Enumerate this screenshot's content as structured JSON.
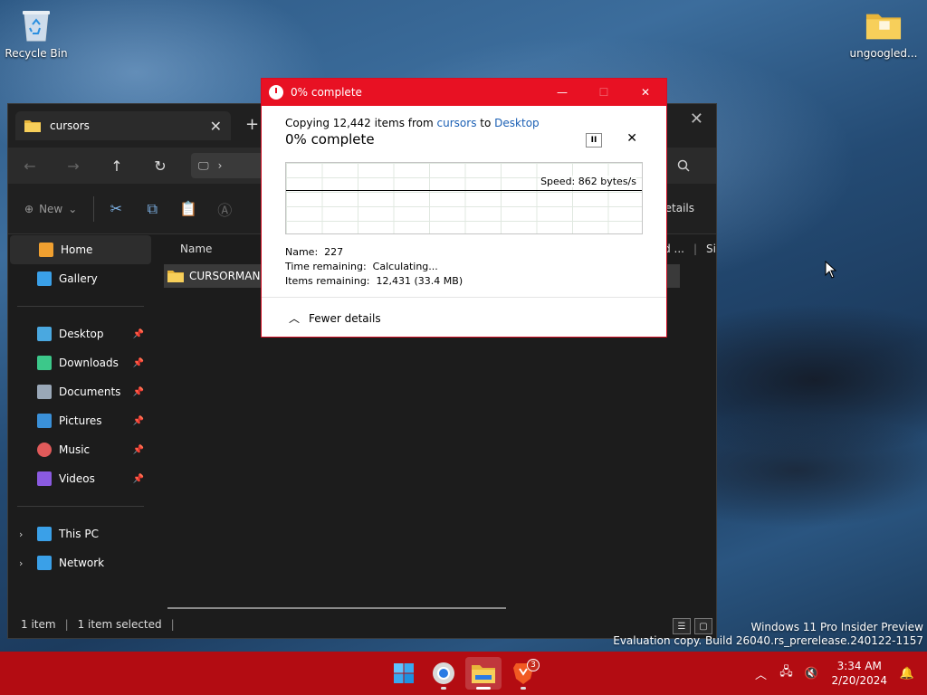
{
  "desktop": {
    "icons": [
      {
        "label": "Recycle Bin",
        "icon": "recycle-bin-icon"
      },
      {
        "label": "ungoogled...",
        "icon": "folder-icon"
      }
    ]
  },
  "explorer": {
    "tab_title": "cursors",
    "toolbar": {
      "new_label": "New",
      "details_label": "Details"
    },
    "sidebar": {
      "top_items": [
        {
          "label": "Home",
          "icon": "home-icon",
          "color": "#f0a030"
        },
        {
          "label": "Gallery",
          "icon": "gallery-icon",
          "color": "#3aa0e8"
        }
      ],
      "quick_access": [
        {
          "label": "Desktop",
          "icon": "desktop-icon",
          "color": "#4aa8e0"
        },
        {
          "label": "Downloads",
          "icon": "downloads-icon",
          "color": "#3cc88a"
        },
        {
          "label": "Documents",
          "icon": "documents-icon",
          "color": "#9aa8b8"
        },
        {
          "label": "Pictures",
          "icon": "pictures-icon",
          "color": "#3a90d8"
        },
        {
          "label": "Music",
          "icon": "music-icon",
          "color": "#e05a5a"
        },
        {
          "label": "Videos",
          "icon": "videos-icon",
          "color": "#8a5ae0"
        }
      ],
      "bottom_items": [
        {
          "label": "This PC",
          "icon": "this-pc-icon",
          "color": "#3aa0e8"
        },
        {
          "label": "Network",
          "icon": "network-icon",
          "color": "#3aa0e8"
        }
      ]
    },
    "columns": {
      "name": "Name",
      "right_1": "ord ...",
      "right_2": "Si"
    },
    "files": [
      {
        "name": "CURSORMANIA",
        "icon": "folder-icon"
      }
    ],
    "status": {
      "items": "1 item",
      "selected": "1 item selected"
    }
  },
  "copy_dialog": {
    "title": "0% complete",
    "copy_prefix": "Copying 12,442 items from",
    "source": "cursors",
    "to_word": "to",
    "destination": "Desktop",
    "percent_text": "0% complete",
    "speed": "Speed: 862 bytes/s",
    "name_label": "Name:",
    "name_value": "227",
    "time_label": "Time remaining:",
    "time_value": "Calculating...",
    "items_label": "Items remaining:",
    "items_value": "12,431 (33.4 MB)",
    "fewer_details": "Fewer details"
  },
  "watermark": {
    "line1": "Windows 11 Pro Insider Preview",
    "line2": "Evaluation copy. Build 26040.rs_prerelease.240122-1157"
  },
  "taskbar": {
    "time": "3:34 AM",
    "date": "2/20/2024",
    "brave_badge": "3",
    "accent": "#b30c12"
  }
}
